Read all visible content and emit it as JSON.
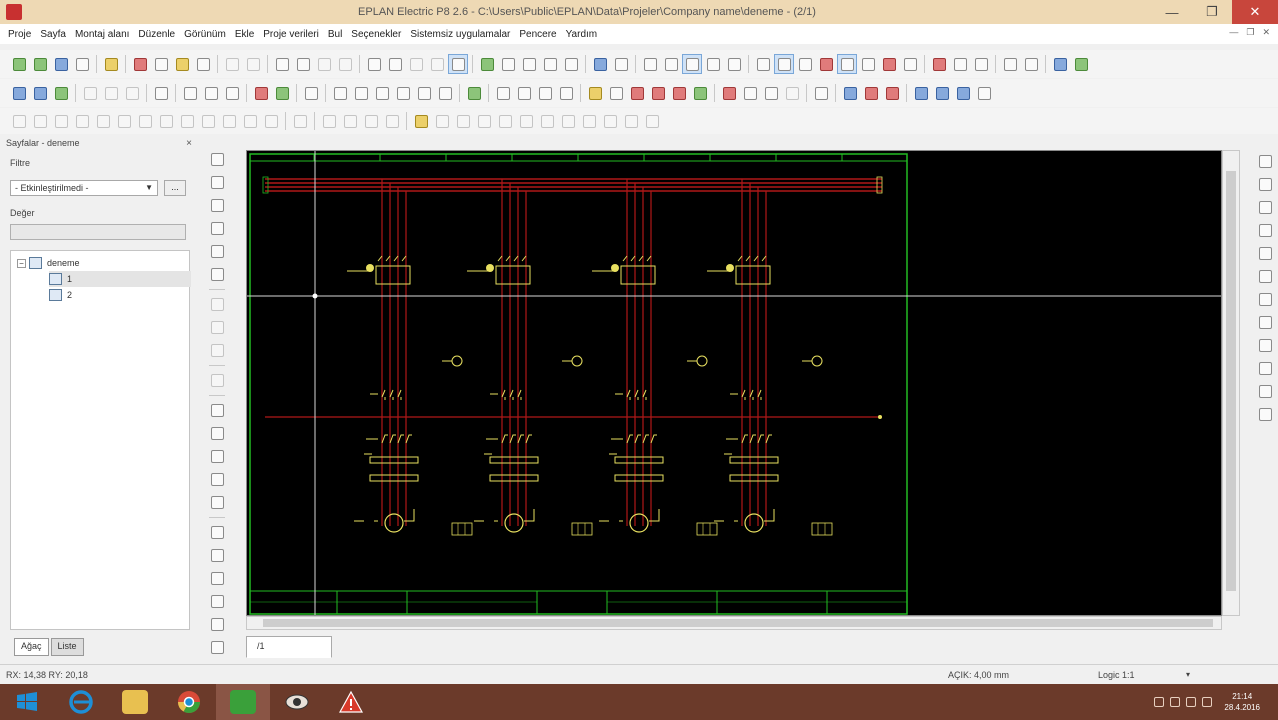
{
  "window": {
    "title": "EPLAN Electric P8 2.6 - C:\\Users\\Public\\EPLAN\\Data\\Projeler\\Company name\\deneme - (2/1)",
    "minimize": "—",
    "maximize": "❐",
    "close": "✕"
  },
  "menu": {
    "items": [
      "Proje",
      "Sayfa",
      "Montaj alanı",
      "Düzenle",
      "Görünüm",
      "Ekle",
      "Proje verileri",
      "Bul",
      "Seçenekler",
      "Sistemsiz uygulamalar",
      "Pencere",
      "Yardım"
    ]
  },
  "navigator": {
    "title": "Sayfalar - deneme",
    "close": "×",
    "filter_label": "Filtre",
    "filter_value": "- Etkinleştirilmedi -",
    "filter_more": "...",
    "value_label": "Değer",
    "value_input": "",
    "tree": {
      "root": "deneme",
      "pages": [
        "1",
        "2"
      ]
    },
    "tabs": [
      "Ağaç",
      "Liste"
    ]
  },
  "page_tabs": [
    "/1"
  ],
  "status": {
    "coords": "RX: 14,38    RY: 20,18",
    "grid": "AÇIK: 4,00 mm",
    "logic": "Logic 1:1",
    "select_arrow": "▾"
  },
  "taskbar": {
    "time": "21:14",
    "date": "28.4.2016",
    "colors": {
      "taskbar": "#6b3a2a",
      "ie": "#1e8fd6",
      "explorer": "#e8c050",
      "chrome": "#d94a38",
      "eplan_green": "#3aa03a",
      "eplan_red": "#d83a2a"
    }
  },
  "schematic": {
    "colors": {
      "background": "#000000",
      "frame": "#22bb22",
      "wire": "#b01818",
      "symbol": "#e8e060",
      "crosshair": "#d8d8d8"
    },
    "circuits": 4
  }
}
